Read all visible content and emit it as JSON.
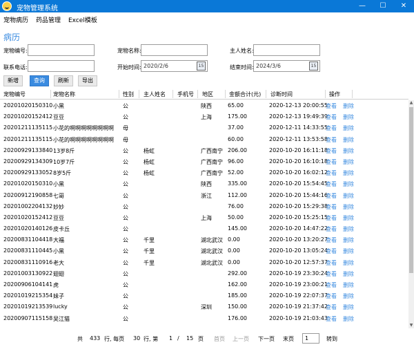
{
  "app": {
    "title": "宠物管理系统"
  },
  "window_controls": {
    "minimize": "—",
    "maximize": "☐",
    "close": "✕"
  },
  "menu": {
    "items": [
      "宠物病历",
      "药品管理",
      "Excel模板"
    ]
  },
  "section": {
    "title": "病历"
  },
  "form": {
    "pet_id_label": "宠物编号:",
    "pet_name_label": "宠物名称:",
    "owner_name_label": "主人姓名:",
    "phone_label": "联系电话:",
    "start_time_label": "开始时间:",
    "start_time_value": "2020/2/6",
    "end_time_label": "结束时间:",
    "end_time_value": "2024/3/6",
    "pet_id_value": "",
    "pet_name_value": "",
    "owner_name_value": "",
    "phone_value": ""
  },
  "toolbar": {
    "add": "新增",
    "query": "查询",
    "refresh": "刷新",
    "export": "导出"
  },
  "table": {
    "columns": [
      "宠物编号",
      "宠物名称",
      "性别",
      "主人姓名",
      "手机号",
      "地区",
      "金额合计(元)",
      "诊断时间",
      "操作"
    ],
    "view_label": "查看",
    "delete_label": "删除",
    "rows": [
      {
        "id": "20201020150310",
        "name": "小黑",
        "sex": "公",
        "owner": "",
        "phone": "",
        "region": "陕西",
        "amount": "65.00",
        "time": "2020-12-13 20:00:55"
      },
      {
        "id": "20201020152412",
        "name": "豆豆",
        "sex": "公",
        "owner": "",
        "phone": "",
        "region": "上海",
        "amount": "175.00",
        "time": "2020-12-13 19:49:39"
      },
      {
        "id": "20201211135115",
        "name": "小花的啊啊啊啊啊啊啊啊",
        "sex": "母",
        "owner": "",
        "phone": "",
        "region": "",
        "amount": "37.00",
        "time": "2020-12-11 14:33:55"
      },
      {
        "id": "20201211135115",
        "name": "小花的啊啊啊啊啊啊啊啊",
        "sex": "母",
        "owner": "",
        "phone": "",
        "region": "",
        "amount": "60.00",
        "time": "2020-12-11 13:53:58"
      },
      {
        "id": "20200929133840",
        "name": "13岁8斤",
        "sex": "公",
        "owner": "杨虹",
        "phone": "",
        "region": "广西南宁",
        "amount": "206.00",
        "time": "2020-10-20 16:11:18"
      },
      {
        "id": "20200929134309",
        "name": "10岁7斤",
        "sex": "公",
        "owner": "杨虹",
        "phone": "",
        "region": "广西南宁",
        "amount": "96.00",
        "time": "2020-10-20 16:10:18"
      },
      {
        "id": "20200929133052",
        "name": "8岁5斤",
        "sex": "公",
        "owner": "杨虹",
        "phone": "",
        "region": "广西南宁",
        "amount": "52.00",
        "time": "2020-10-20 16:02:12"
      },
      {
        "id": "20201020150310",
        "name": "小黑",
        "sex": "公",
        "owner": "",
        "phone": "",
        "region": "陕西",
        "amount": "335.00",
        "time": "2020-10-20 15:54:45"
      },
      {
        "id": "20200912190858",
        "name": "七哥",
        "sex": "公",
        "owner": "",
        "phone": "",
        "region": "浙江",
        "amount": "112.00",
        "time": "2020-10-20 15:44:16"
      },
      {
        "id": "20201002204132",
        "name": "妙妙",
        "sex": "公",
        "owner": "",
        "phone": "",
        "region": "",
        "amount": "76.00",
        "time": "2020-10-20 15:29:38"
      },
      {
        "id": "20201020152412",
        "name": "豆豆",
        "sex": "公",
        "owner": "",
        "phone": "",
        "region": "上海",
        "amount": "50.00",
        "time": "2020-10-20 15:25:15"
      },
      {
        "id": "20201020140126",
        "name": "皮卡丘",
        "sex": "公",
        "owner": "",
        "phone": "",
        "region": "",
        "amount": "145.00",
        "time": "2020-10-20 14:47:22"
      },
      {
        "id": "20200831104418",
        "name": "大福",
        "sex": "公",
        "owner": "千里",
        "phone": "",
        "region": "湖北武汉",
        "amount": "0.00",
        "time": "2020-10-20 13:20:27"
      },
      {
        "id": "20200831110445",
        "name": "小黑",
        "sex": "公",
        "owner": "千里",
        "phone": "",
        "region": "湖北武汉",
        "amount": "0.00",
        "time": "2020-10-20 13:05:24"
      },
      {
        "id": "20200831110916",
        "name": "老大",
        "sex": "公",
        "owner": "千里",
        "phone": "",
        "region": "湖北武汉",
        "amount": "0.00",
        "time": "2020-10-20 12:57:37"
      },
      {
        "id": "20201003130922",
        "name": "翅翅",
        "sex": "公",
        "owner": "",
        "phone": "",
        "region": "",
        "amount": "292.00",
        "time": "2020-10-19 23:30:24"
      },
      {
        "id": "20200906104141",
        "name": "虎",
        "sex": "公",
        "owner": "",
        "phone": "",
        "region": "",
        "amount": "162.00",
        "time": "2020-10-19 23:00:21"
      },
      {
        "id": "20201019215354",
        "name": "妹子",
        "sex": "公",
        "owner": "",
        "phone": "",
        "region": "",
        "amount": "185.00",
        "time": "2020-10-19 22:07:37"
      },
      {
        "id": "20201019213539",
        "name": "lucky",
        "sex": "公",
        "owner": "",
        "phone": "",
        "region": "深圳",
        "amount": "150.00",
        "time": "2020-10-19 21:37:42"
      },
      {
        "id": "20200907115158",
        "name": "吴江猫",
        "sex": "公",
        "owner": "",
        "phone": "",
        "region": "",
        "amount": "176.00",
        "time": "2020-10-19 21:03:43"
      }
    ]
  },
  "pager": {
    "total_prefix": "共",
    "total": "433",
    "total_suffix": "行, 每页",
    "per_page": "30",
    "per_page_suffix": "行, 第",
    "current": "1",
    "slash": "/",
    "pages": "15",
    "pages_suffix": "页",
    "first": "首页",
    "prev": "上一页",
    "next": "下一页",
    "last": "末页",
    "goto_value": "1",
    "goto": "转到"
  }
}
